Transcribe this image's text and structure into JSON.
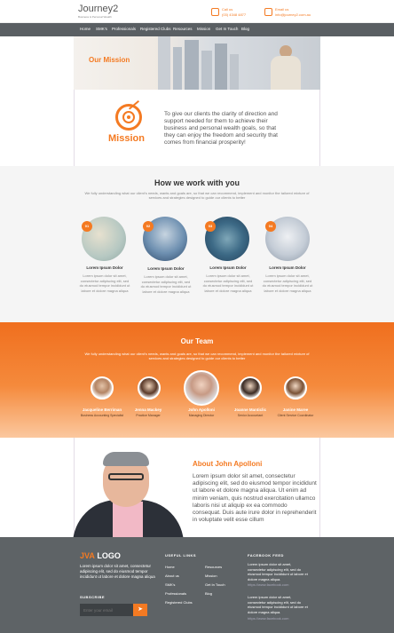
{
  "header": {
    "logo": "Journey2",
    "logo_sub": "Business & Personal Wealth",
    "call_label": "Call us",
    "phone": "(03) 4348 4877",
    "email_label": "Email us",
    "email": "info@journey2.com.au"
  },
  "nav": [
    "Home",
    "SMK's",
    "Professionals",
    "Registered Clubs",
    "Resources",
    "Mission",
    "Get In Touch",
    "Blog"
  ],
  "hero": {
    "title_plain": "Our ",
    "title_accent": "Mission"
  },
  "mission": {
    "label": "Mission",
    "text": "To give our clients the clarity of direction and support needed for them to achieve their business and personal wealth goals, so that they can enjoy the freedom and security that comes from financial prosperity!"
  },
  "how": {
    "title": "How we work with you",
    "intro": "We fully understanding what our client's needs, wants and goals are, so that we can recommend, implement and monitor the tailored mixture of services and strategies designed to guide our clients to better",
    "steps": [
      {
        "num": "01",
        "title": "Lorem Ipsum Dolor",
        "text": "Lorem ipsum dolor sit amet, consectetur adipiscing elit, sed do eiusmod tempor incididunt ut labore et dolore magna aliqua"
      },
      {
        "num": "02",
        "title": "Lorem Ipsum Dolor",
        "text": "Lorem ipsum dolor sit amet, consectetur adipiscing elit, sed do eiusmod tempor incididunt ut labore et dolore magna aliqua"
      },
      {
        "num": "03",
        "title": "Lorem Ipsum Dolor",
        "text": "Lorem ipsum dolor sit amet, consectetur adipiscing elit, sed do eiusmod tempor incididunt ut labore et dolore magna aliqua"
      },
      {
        "num": "04",
        "title": "Lorem Ipsum Dolor",
        "text": "Lorem ipsum dolor sit amet, consectetur adipiscing elit, sed do eiusmod tempor incididunt ut labore et dolore magna aliqua"
      }
    ]
  },
  "team": {
    "title": "Our Team",
    "intro": "We fully understanding what our client's needs, wants and goals are, so that we can recommend, implement and monitor the tailored mixture of services and strategies designed to guide our clients to better",
    "members": [
      {
        "name": "Jacqueline Berriman",
        "role": "Business Accounting Specialist"
      },
      {
        "name": "Jenna Mackey",
        "role": "Practice Manager"
      },
      {
        "name": "John Apolloni",
        "role": "Managing Director"
      },
      {
        "name": "Joanne Manticlic",
        "role": "Senior Accountant"
      },
      {
        "name": "Janine Maree",
        "role": "Client Service Coordinator"
      }
    ]
  },
  "about": {
    "title_plain": "About ",
    "title_accent": "John Apolloni",
    "text": "Lorem ipsum dolor sit amet, consectetur adipiscing elit, sed do eiusmod tempor incididunt ut labore et dolore magna aliqua. Ut enim ad minim veniam, quis nostrud exercitation ullamco laboris nisi ut aliquip ex ea commodo consequat. Duis aute irure dolor in reprehenderit in voluptate velit esse cillum"
  },
  "footer": {
    "logo_accent": "JVA",
    "logo_plain": " LOGO",
    "about": "Lorem ipsum dolor sit amet, consectetur adipiscing elit, sed do eiusmod tempor incididunt ut labore et dolore magna aliqua",
    "subscribe_label": "SUBSCRIBE",
    "subscribe_placeholder": "Enter your email",
    "useful_links_heading": "USEFUL LINKS",
    "links_col1": [
      "Home",
      "About us",
      "SMK's",
      "Professionals",
      "Registered Clubs"
    ],
    "links_col2": [
      "Resources",
      "Mission",
      "Get In Touch",
      "Blog"
    ],
    "facebook_heading": "FACEBOOK FEED",
    "facebook_posts": [
      {
        "text": "Lorem ipsum dolor sit amet, consectetur adipiscing elit, sed do eiusmod tempor incididunt ut labore et dolore magna aliqua.",
        "link": "https://www.facebook.com"
      },
      {
        "text": "Lorem ipsum dolor sit amet, consectetur adipiscing elit, sed do eiusmod tempor incididunt ut labore et dolore magna aliqua.",
        "link": "https://www.facebook.com"
      }
    ]
  },
  "colors": {
    "accent": "#f47a22",
    "nav": "#5a5f63",
    "footer": "#5e6366"
  }
}
